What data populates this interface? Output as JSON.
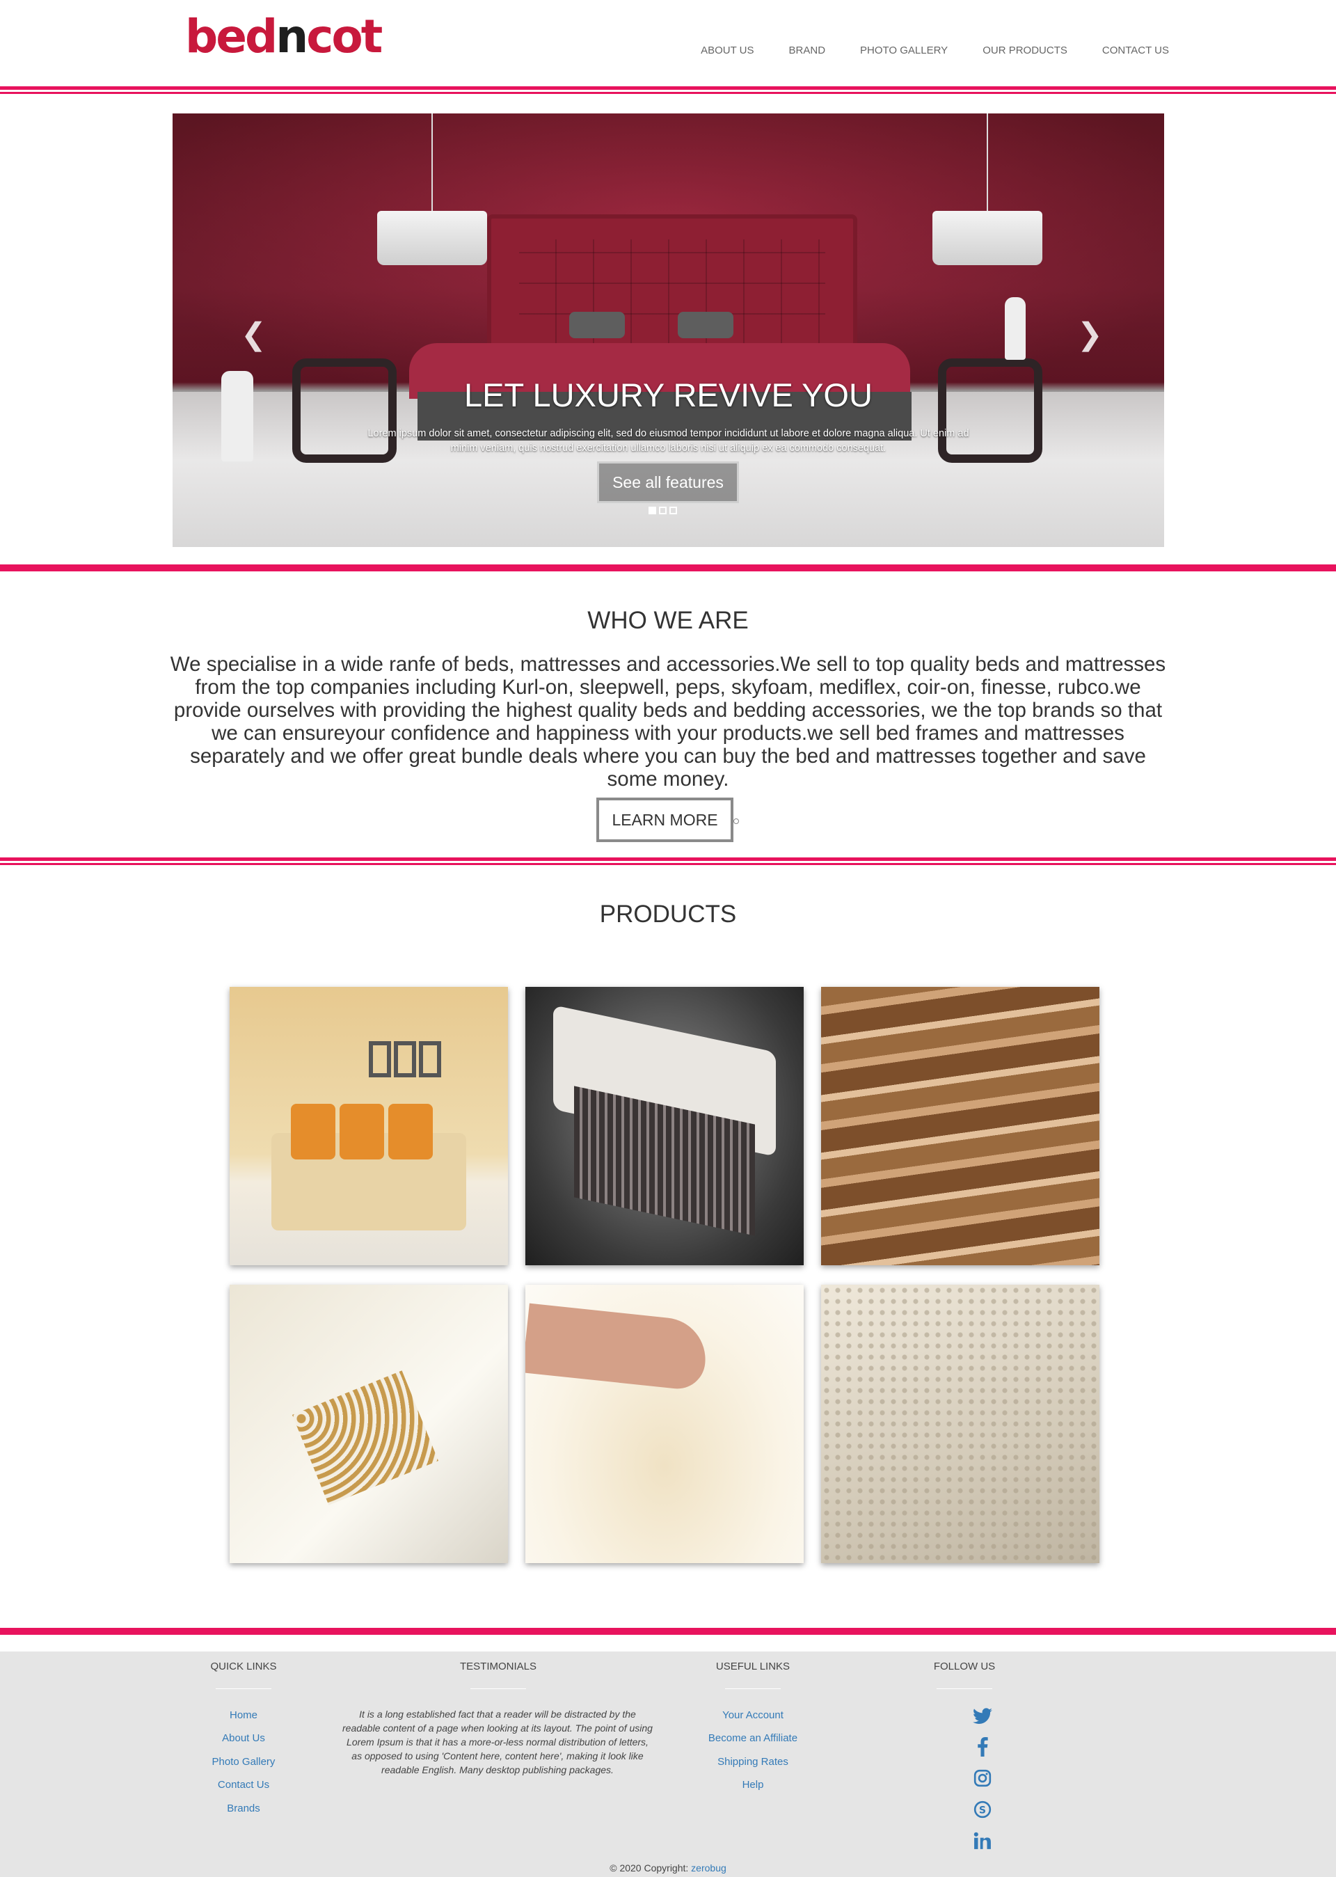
{
  "brand": {
    "logo_part1": "bed",
    "logo_part2": "n",
    "logo_part3": "cot",
    "logo_color": "#c8193c"
  },
  "nav": [
    "ABOUT US",
    "BRAND",
    "PHOTO GALLERY",
    "OUR PRODUCTS",
    "CONTACT US"
  ],
  "accent_color": "#e8135d",
  "hero": {
    "title": "LET LUXURY REVIVE YOU",
    "text": "Lorem ipsum dolor sit amet, consectetur adipiscing elit, sed do eiusmod tempor incididunt ut labore et dolore magna aliqua. Ut enim ad minim veniam, quis nostrud exercitation ullamco laboris nisi ut aliquip ex ea commodo consequat.",
    "button": "See all features",
    "prev_icon": "chevron-left-icon",
    "next_icon": "chevron-right-icon",
    "slides_count": 3,
    "active_slide": 1
  },
  "about": {
    "heading": "WHO WE ARE",
    "text": "We specialise in a wide ranfe of beds, mattresses and accessories.We sell to top quality beds and mattresses from the top companies including Kurl-on, sleepwell, peps, skyfoam, mediflex, coir-on, finesse, rubco.we provide ourselves with providing the highest quality beds and bedding accessories, we the top brands so that we can ensureyour confidence and happiness with your products.we sell bed frames and mattresses separately and we offer great bundle deals where you can buy the bed and mattresses together and save some money.",
    "button": "LEARN MORE"
  },
  "products": {
    "heading": "PRODUCTS",
    "items": [
      "sofa",
      "spring mattress",
      "coir layers",
      "pocket spring mattress",
      "memory foam",
      "latex foam"
    ]
  },
  "footer": {
    "quick_links_title": "QUICK LINKS",
    "quick_links": [
      "Home",
      "About Us",
      "Photo Gallery",
      "Contact Us",
      "Brands"
    ],
    "testimonials_title": "TESTIMONIALS",
    "testimonial": "It is a long established fact that a reader will be distracted by the readable content of a page when looking at its layout. The point of using Lorem Ipsum is that it has a more-or-less normal distribution of letters, as opposed to using 'Content here, content here', making it look like readable English. Many desktop publishing packages.",
    "useful_links_title": "USEFUL LINKS",
    "useful_links": [
      "Your Account",
      "Become an Affiliate",
      "Shipping Rates",
      "Help"
    ],
    "follow_title": "FOLLOW US",
    "social": [
      "twitter-icon",
      "facebook-icon",
      "instagram-icon",
      "skype-icon",
      "linkedin-icon"
    ],
    "copyright": "© 2020 Copyright:",
    "copyright_link": "zerobug"
  }
}
